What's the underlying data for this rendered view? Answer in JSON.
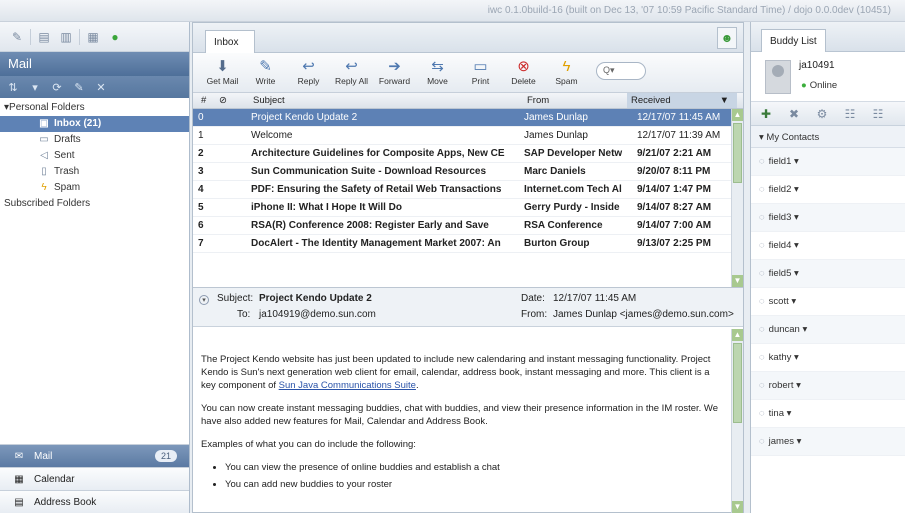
{
  "build_info": "iwc 0.1.0build-16 (built on Dec 13, '07 10:59 Pacific Standard Time) / dojo 0.0.0dev (10451)",
  "left": {
    "mail_title": "Mail",
    "folders": [
      {
        "label": "▾Personal Folders",
        "icon": "",
        "level": 0,
        "selected": false
      },
      {
        "label": "Inbox (21)",
        "icon": "inbox-icon",
        "level": 2,
        "selected": true
      },
      {
        "label": "Drafts",
        "icon": "drafts-icon",
        "level": 2,
        "selected": false
      },
      {
        "label": "Sent",
        "icon": "sent-icon",
        "level": 2,
        "selected": false
      },
      {
        "label": "Trash",
        "icon": "trash-icon",
        "level": 2,
        "selected": false
      },
      {
        "label": "Spam",
        "icon": "spam-icon",
        "level": 2,
        "selected": false
      },
      {
        "label": "Subscribed Folders",
        "icon": "",
        "level": 0,
        "selected": false
      }
    ],
    "bottom_tabs": [
      {
        "label": "Mail",
        "badge": "21",
        "active": true
      },
      {
        "label": "Calendar",
        "badge": "",
        "active": false
      },
      {
        "label": "Address Book",
        "badge": "",
        "active": false
      }
    ]
  },
  "center": {
    "tab_label": "Inbox",
    "toolbar": {
      "get_mail": "Get Mail",
      "write": "Write",
      "reply": "Reply",
      "reply_all": "Reply All",
      "forward": "Forward",
      "move": "Move",
      "print": "Print",
      "delete": "Delete",
      "spam": "Spam"
    },
    "search_placeholder": "Q▾",
    "columns": {
      "num": "#",
      "subject": "Subject",
      "from": "From",
      "received": "Received"
    },
    "messages": [
      {
        "num": "0",
        "subject": "Project Kendo Update 2",
        "from": "James Dunlap",
        "date": "12/17/07 11:45 AM",
        "unread": false,
        "selected": true
      },
      {
        "num": "1",
        "subject": "Welcome",
        "from": "James Dunlap",
        "date": "12/17/07 11:39 AM",
        "unread": false,
        "selected": false
      },
      {
        "num": "2",
        "subject": "Architecture Guidelines for Composite Apps, New CE",
        "from": "SAP Developer Netw",
        "date": "9/21/07 2:21 AM",
        "unread": true,
        "selected": false
      },
      {
        "num": "3",
        "subject": "Sun Communication Suite - Download Resources",
        "from": "Marc Daniels",
        "date": "9/20/07 8:11 PM",
        "unread": true,
        "selected": false
      },
      {
        "num": "4",
        "subject": "PDF: Ensuring the Safety of Retail Web Transactions",
        "from": "Internet.com Tech Al",
        "date": "9/14/07 1:47 PM",
        "unread": true,
        "selected": false
      },
      {
        "num": "5",
        "subject": "iPhone II: What I Hope It Will Do",
        "from": "Gerry Purdy - Inside",
        "date": "9/14/07 8:27 AM",
        "unread": true,
        "selected": false
      },
      {
        "num": "6",
        "subject": "RSA(R) Conference 2008: Register Early and Save",
        "from": "RSA Conference",
        "date": "9/14/07 7:00 AM",
        "unread": true,
        "selected": false
      },
      {
        "num": "7",
        "subject": "DocAlert - The Identity Management Market 2007: An",
        "from": "Burton Group",
        "date": "9/13/07 2:25 PM",
        "unread": true,
        "selected": false
      }
    ],
    "preview": {
      "subject_label": "Subject:",
      "subject": "Project Kendo Update 2",
      "to_label": "To:",
      "to": "ja104919@demo.sun.com",
      "date_label": "Date:",
      "date": "12/17/07 11:45 AM",
      "from_label": "From:",
      "from": "James Dunlap <james@demo.sun.com>",
      "body_p1": "The Project Kendo website has just been updated to include new calendaring and instant messaging functionality. Project Kendo is Sun's next generation web client for email, calendar, address book, instant messaging and more. This client is a key component of",
      "body_link": "Sun Java Communications Suite",
      "body_p2": "You can now create instant messaging buddies, chat with buddies, and view their presence information in the IM roster. We have also added new features for Mail, Calendar and Address Book.",
      "body_p3": "Examples of what you can do include the following:",
      "bullets": [
        "You can view the presence of online buddies and establish a chat",
        "You can add new buddies to your roster"
      ]
    }
  },
  "right": {
    "tab_label": "Buddy List",
    "user_name": "ja10491",
    "user_status": "Online",
    "group_label": "▾ My Contacts",
    "contacts": [
      "field1",
      "field2",
      "field3",
      "field4",
      "field5",
      "scott",
      "duncan",
      "kathy",
      "robert",
      "tina",
      "james"
    ]
  }
}
